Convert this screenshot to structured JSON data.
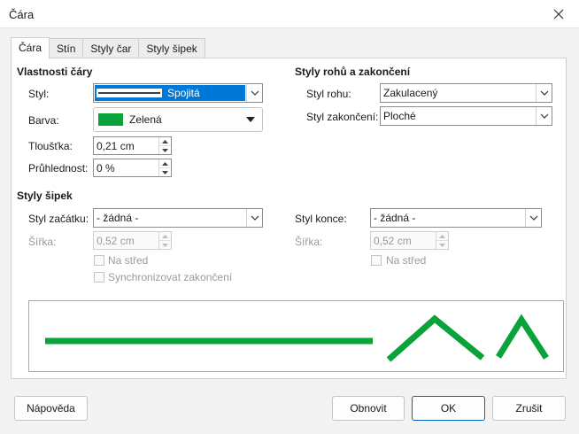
{
  "window": {
    "title": "Čára"
  },
  "tabs": [
    {
      "label": "Čára"
    },
    {
      "label": "Stín"
    },
    {
      "label": "Styly čar"
    },
    {
      "label": "Styly šipek"
    }
  ],
  "line_props": {
    "title": "Vlastnosti čáry",
    "style_label": "Styl:",
    "style_value": "Spojitá",
    "color_label": "Barva:",
    "color_value": "Zelená",
    "width_label": "Tloušťka:",
    "width_value": "0,21 cm",
    "transparency_label": "Průhlednost:",
    "transparency_value": "0 %"
  },
  "corner_props": {
    "title": "Styly rohů a zakončení",
    "corner_label": "Styl rohu:",
    "corner_value": "Zakulacený",
    "cap_label": "Styl zakončení:",
    "cap_value": "Ploché"
  },
  "arrow_props": {
    "title": "Styly šipek",
    "start_label": "Styl začátku:",
    "start_value": "- žádná -",
    "start_width_label": "Šířka:",
    "start_width_value": "0,52 cm",
    "start_center_label": "Na střed",
    "sync_label": "Synchronizovat zakončení",
    "end_label": "Styl konce:",
    "end_value": "- žádná -",
    "end_width_label": "Šířka:",
    "end_width_value": "0,52 cm",
    "end_center_label": "Na střed"
  },
  "buttons": {
    "help": "Nápověda",
    "reset": "Obnovit",
    "ok": "OK",
    "cancel": "Zrušit"
  },
  "colors": {
    "line_green": "#0aa23a",
    "selection_blue": "#0078d7",
    "default_button_border": "#0067c0"
  }
}
